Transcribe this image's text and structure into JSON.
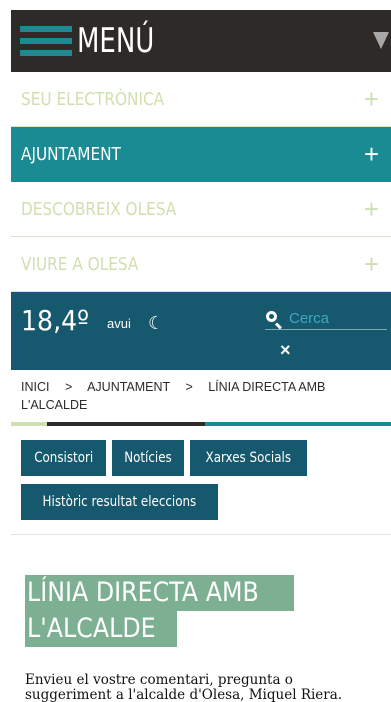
{
  "header": {
    "menu_label": "MENÚ"
  },
  "menu": {
    "items": [
      {
        "label": "SEU ELECTRÒNICA",
        "expand": "+"
      },
      {
        "label": "AJUNTAMENT",
        "expand": "+"
      },
      {
        "label": "DESCOBREIX OLESA",
        "expand": "+"
      },
      {
        "label": "VIURE A OLESA",
        "expand": "+"
      }
    ]
  },
  "info_bar": {
    "temperature": "18,4º",
    "day_label": "avui",
    "search_placeholder": "Cerca",
    "close": "×"
  },
  "breadcrumb": {
    "items": [
      "INICI",
      "AJUNTAMENT",
      "LÍNIA DIRECTA AMB L'ALCALDE"
    ],
    "separator": ">"
  },
  "tabs": [
    "Consistori",
    "Notícies",
    "Xarxes Socials",
    "Històric resultat eleccions"
  ],
  "page": {
    "title_line1": "LÍNIA DIRECTA AMB",
    "title_line2": "L'ALCALDE",
    "intro": "Envieu el vostre comentari, pregunta o suggeriment a l'alcalde d'Olesa, Miquel Riera."
  },
  "colors": {
    "dark": "#2e2a28",
    "teal": "#1a8a93",
    "navy_teal": "#16596e",
    "light_green": "#cfe0b0",
    "title_green": "#7daf92"
  }
}
